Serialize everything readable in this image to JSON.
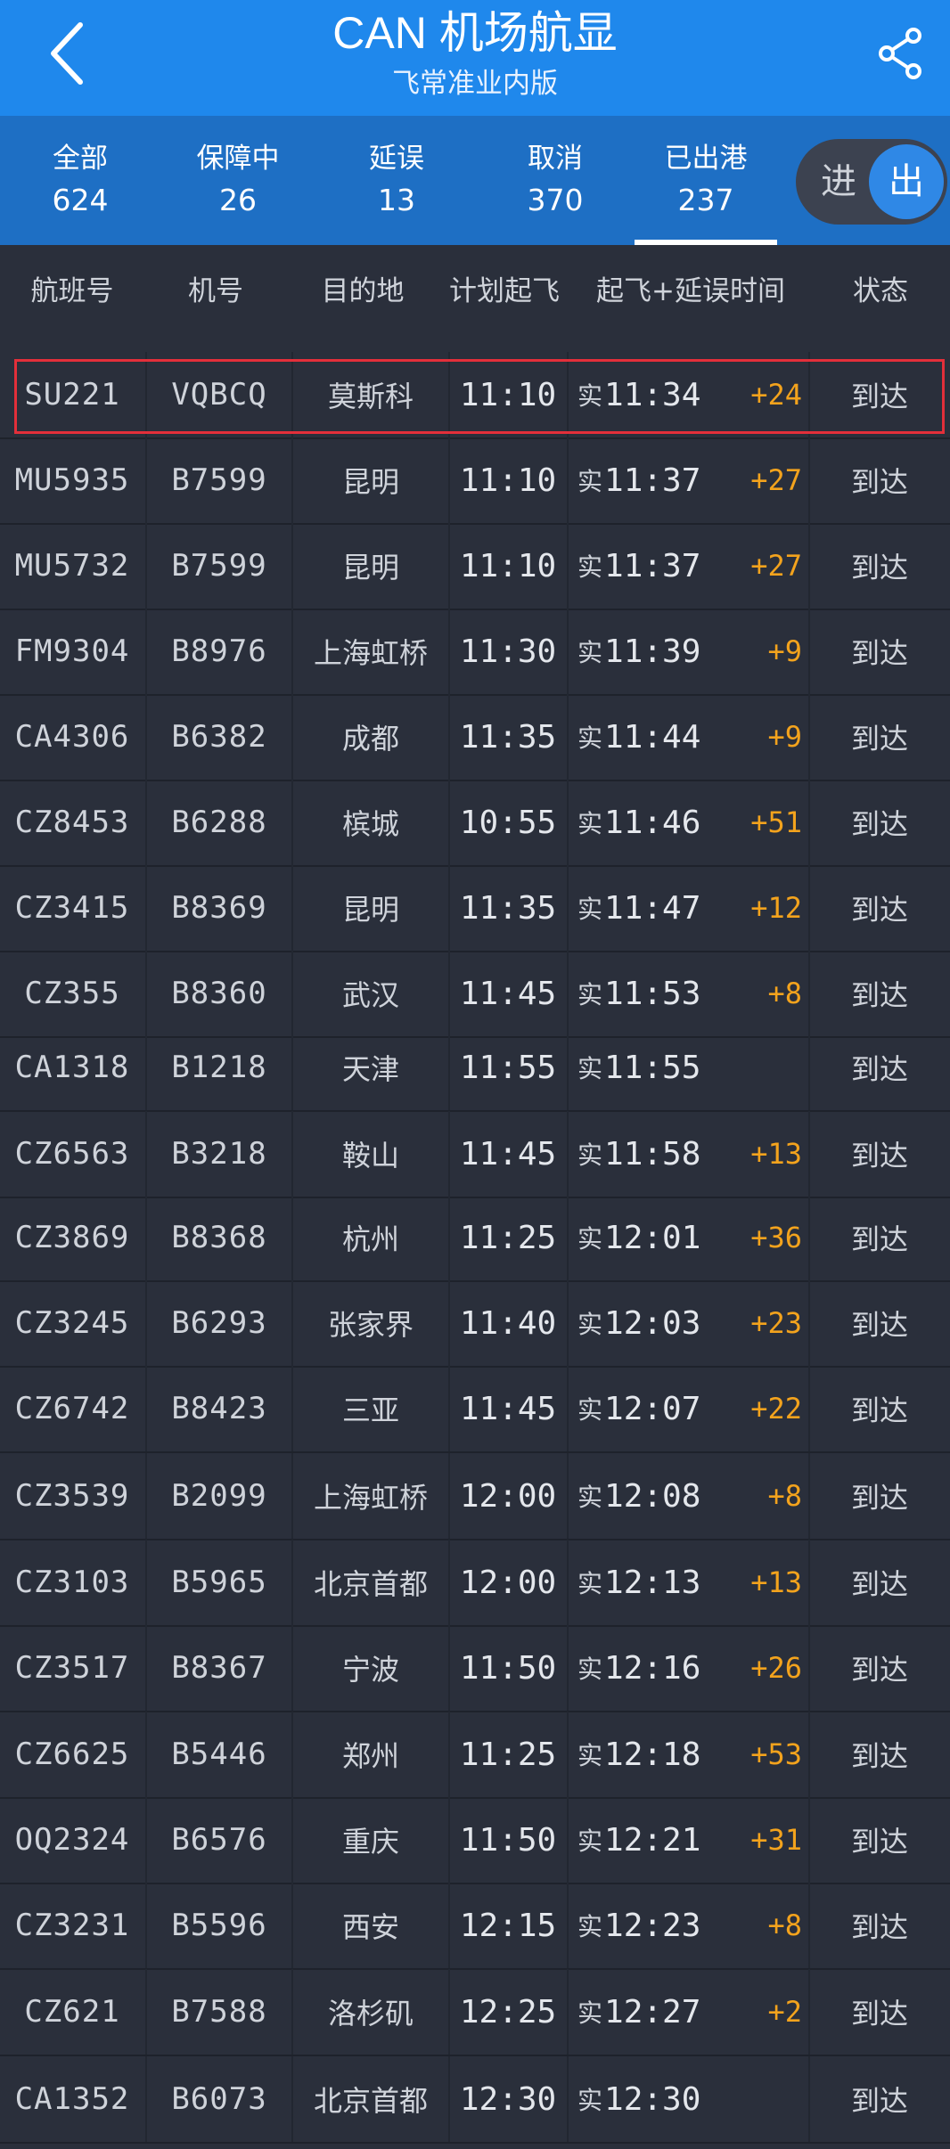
{
  "header": {
    "title": "CAN 机场航显",
    "subtitle": "飞常准业内版",
    "back_icon": "chevron-left-icon",
    "share_icon": "share-icon"
  },
  "tabs": [
    {
      "label": "全部",
      "count": "624"
    },
    {
      "label": "保障中",
      "count": "26"
    },
    {
      "label": "延误",
      "count": "13"
    },
    {
      "label": "取消",
      "count": "370"
    },
    {
      "label": "已出港",
      "count": "237",
      "active": true
    }
  ],
  "toggle": {
    "in_label": "进",
    "out_label": "出",
    "selected": "出"
  },
  "columns": [
    "航班号",
    "机号",
    "目的地",
    "计划起飞",
    "起飞+延误时间",
    "状态"
  ],
  "actual_prefix": "实",
  "colors": {
    "header_blue": "#1f88ec",
    "tab_blue": "#1e6fc4",
    "delay_orange": "#f3a31d",
    "highlight_red": "#e32f3a"
  },
  "rows": [
    {
      "flight": "SU221",
      "reg": "VQBCQ",
      "dest": "莫斯科",
      "sched": "11:10",
      "actual": "11:34",
      "delay": "+24",
      "status": "到达",
      "highlighted": true
    },
    {
      "flight": "MU5935",
      "reg": "B7599",
      "dest": "昆明",
      "sched": "11:10",
      "actual": "11:37",
      "delay": "+27",
      "status": "到达"
    },
    {
      "flight": "MU5732",
      "reg": "B7599",
      "dest": "昆明",
      "sched": "11:10",
      "actual": "11:37",
      "delay": "+27",
      "status": "到达"
    },
    {
      "flight": "FM9304",
      "reg": "B8976",
      "dest": "上海虹桥",
      "sched": "11:30",
      "actual": "11:39",
      "delay": "+9",
      "status": "到达"
    },
    {
      "flight": "CA4306",
      "reg": "B6382",
      "dest": "成都",
      "sched": "11:35",
      "actual": "11:44",
      "delay": "+9",
      "status": "到达"
    },
    {
      "flight": "CZ8453",
      "reg": "B6288",
      "dest": "槟城",
      "sched": "10:55",
      "actual": "11:46",
      "delay": "+51",
      "status": "到达"
    },
    {
      "flight": "CZ3415",
      "reg": "B8369",
      "dest": "昆明",
      "sched": "11:35",
      "actual": "11:47",
      "delay": "+12",
      "status": "到达"
    },
    {
      "flight": "CZ355",
      "reg": "B8360",
      "dest": "武汉",
      "sched": "11:45",
      "actual": "11:53",
      "delay": "+8",
      "status": "到达"
    },
    {
      "flight": "CA1318",
      "reg": "B1218",
      "dest": "天津",
      "sched": "11:55",
      "actual": "11:55",
      "delay": "",
      "status": "到达"
    },
    {
      "flight": "CZ6563",
      "reg": "B3218",
      "dest": "鞍山",
      "sched": "11:45",
      "actual": "11:58",
      "delay": "+13",
      "status": "到达"
    },
    {
      "flight": "CZ3869",
      "reg": "B8368",
      "dest": "杭州",
      "sched": "11:25",
      "actual": "12:01",
      "delay": "+36",
      "status": "到达"
    },
    {
      "flight": "CZ3245",
      "reg": "B6293",
      "dest": "张家界",
      "sched": "11:40",
      "actual": "12:03",
      "delay": "+23",
      "status": "到达"
    },
    {
      "flight": "CZ6742",
      "reg": "B8423",
      "dest": "三亚",
      "sched": "11:45",
      "actual": "12:07",
      "delay": "+22",
      "status": "到达"
    },
    {
      "flight": "CZ3539",
      "reg": "B2099",
      "dest": "上海虹桥",
      "sched": "12:00",
      "actual": "12:08",
      "delay": "+8",
      "status": "到达"
    },
    {
      "flight": "CZ3103",
      "reg": "B5965",
      "dest": "北京首都",
      "sched": "12:00",
      "actual": "12:13",
      "delay": "+13",
      "status": "到达"
    },
    {
      "flight": "CZ3517",
      "reg": "B8367",
      "dest": "宁波",
      "sched": "11:50",
      "actual": "12:16",
      "delay": "+26",
      "status": "到达"
    },
    {
      "flight": "CZ6625",
      "reg": "B5446",
      "dest": "郑州",
      "sched": "11:25",
      "actual": "12:18",
      "delay": "+53",
      "status": "到达"
    },
    {
      "flight": "OQ2324",
      "reg": "B6576",
      "dest": "重庆",
      "sched": "11:50",
      "actual": "12:21",
      "delay": "+31",
      "status": "到达"
    },
    {
      "flight": "CZ3231",
      "reg": "B5596",
      "dest": "西安",
      "sched": "12:15",
      "actual": "12:23",
      "delay": "+8",
      "status": "到达"
    },
    {
      "flight": "CZ621",
      "reg": "B7588",
      "dest": "洛杉矶",
      "sched": "12:25",
      "actual": "12:27",
      "delay": "+2",
      "status": "到达"
    },
    {
      "flight": "CA1352",
      "reg": "B6073",
      "dest": "北京首都",
      "sched": "12:30",
      "actual": "12:30",
      "delay": "",
      "status": "到达"
    }
  ]
}
